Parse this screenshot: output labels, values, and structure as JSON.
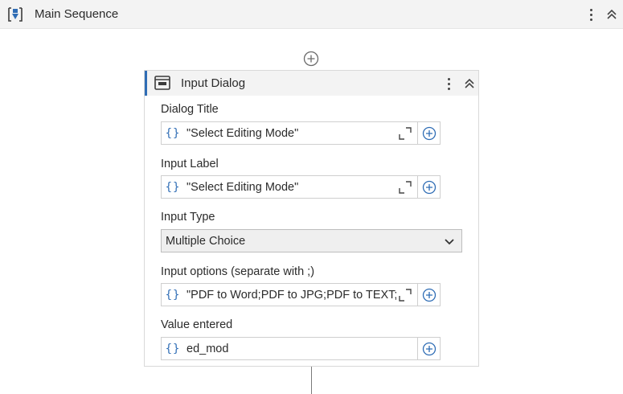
{
  "sequence": {
    "title": "Main Sequence"
  },
  "activity": {
    "title": "Input Dialog",
    "fields": {
      "dialog_title": {
        "label": "Dialog Title",
        "value": "\"Select Editing Mode\""
      },
      "input_label": {
        "label": "Input Label",
        "value": "\"Select Editing Mode\""
      },
      "input_type": {
        "label": "Input Type",
        "value": "Multiple Choice"
      },
      "input_options": {
        "label": "Input options (separate with ;)",
        "value": "\"PDF to Word;PDF to JPG;PDF to TEXT;WOR"
      },
      "value_entered": {
        "label": "Value entered",
        "value": "ed_mod"
      }
    },
    "expression_glyph": "{}"
  },
  "icons": {
    "sequence": "sequence-icon",
    "dialog": "input-dialog-icon",
    "more": "more-vertical-icon",
    "collapse": "double-chevron-up-icon",
    "add": "plus-circle-icon",
    "expand": "expand-editor-icon",
    "dropdown": "chevron-down-icon"
  },
  "colors": {
    "accent": "#2f6db5",
    "header_bg": "#f3f3f3",
    "border": "#d9d9d9"
  }
}
